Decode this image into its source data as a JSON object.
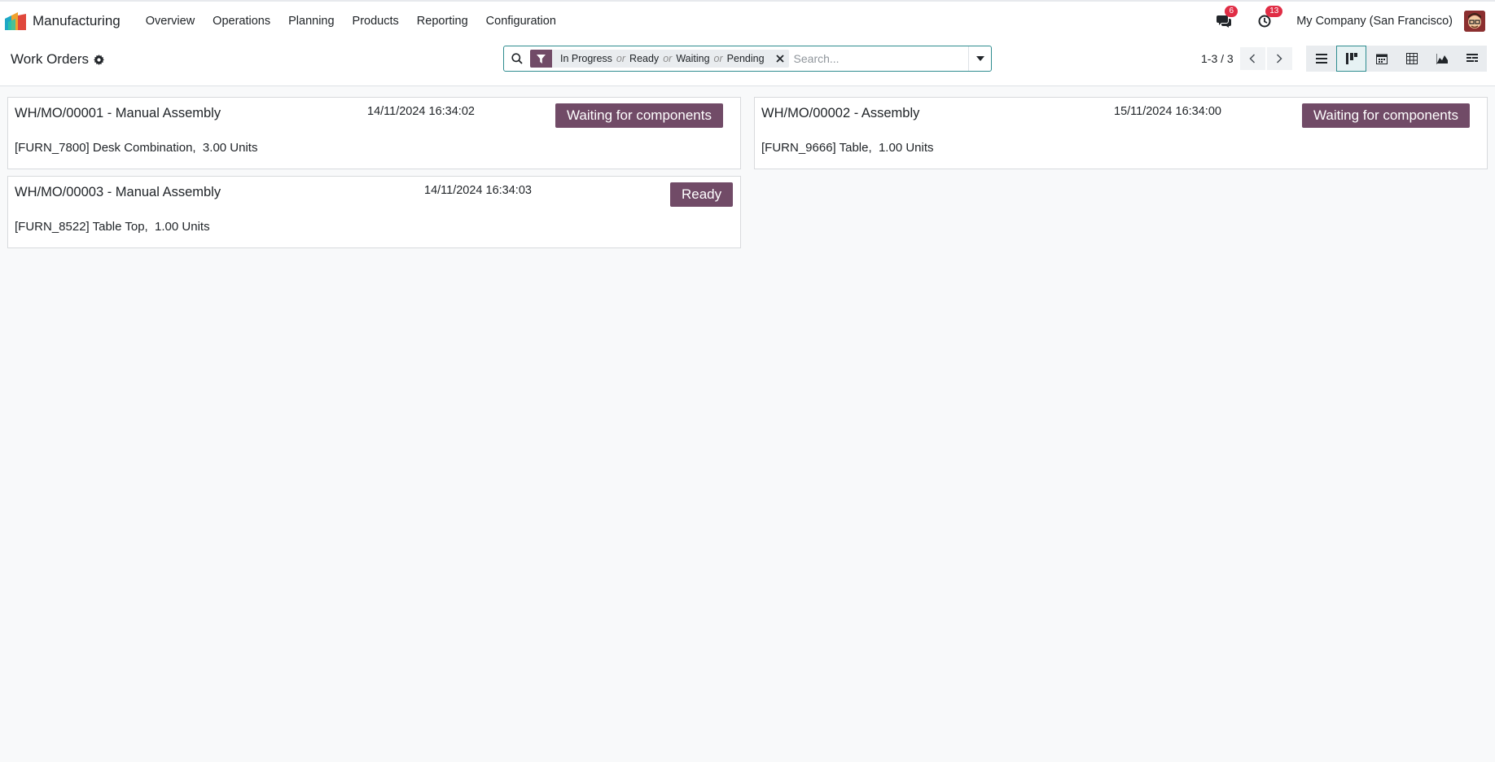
{
  "app": {
    "name": "Manufacturing",
    "logo_icon": "manufacturing-app-icon"
  },
  "menu": [
    {
      "label": "Overview"
    },
    {
      "label": "Operations"
    },
    {
      "label": "Planning"
    },
    {
      "label": "Products"
    },
    {
      "label": "Reporting"
    },
    {
      "label": "Configuration"
    }
  ],
  "systray": {
    "messages_count": "6",
    "activities_count": "13",
    "company": "My Company (San Francisco)"
  },
  "control_panel": {
    "title": "Work Orders",
    "search": {
      "facet_values": [
        "In Progress",
        "Ready",
        "Waiting",
        "Pending"
      ],
      "separator": "or",
      "placeholder": "Search..."
    },
    "pager": "1-3 / 3",
    "views": [
      "list",
      "kanban",
      "calendar",
      "pivot",
      "graph",
      "gantt"
    ],
    "active_view": "kanban"
  },
  "colors": {
    "brand": "#714b67",
    "accent": "#2e8c8f",
    "badge": "#e02d45"
  },
  "cards": [
    {
      "title": "WH/MO/00001 - Manual Assembly",
      "date": "14/11/2024 16:34:02",
      "status": "Waiting for components",
      "product": "[FURN_7800] Desk Combination,  3.00 Units"
    },
    {
      "title": "WH/MO/00002 - Assembly",
      "date": "15/11/2024 16:34:00",
      "status": "Waiting for components",
      "product": "[FURN_9666] Table,  1.00 Units"
    },
    {
      "title": "WH/MO/00003 - Manual Assembly",
      "date": "14/11/2024 16:34:03",
      "status": "Ready",
      "product": "[FURN_8522] Table Top,  1.00 Units"
    }
  ]
}
